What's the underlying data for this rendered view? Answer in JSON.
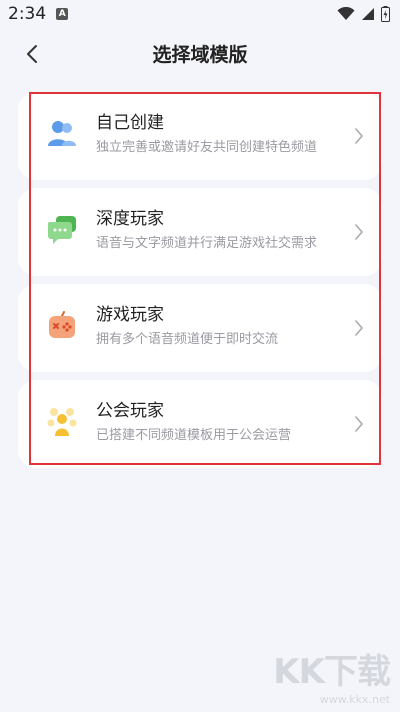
{
  "status": {
    "time": "2:34",
    "notif_glyph": "A"
  },
  "header": {
    "title": "选择域模版",
    "back_icon": "chevron-left-icon"
  },
  "templates": [
    {
      "title": "自己创建",
      "desc": "独立完善或邀请好友共同创建特色频道",
      "icon": "people-icon",
      "color": "#5b9bea"
    },
    {
      "title": "深度玩家",
      "desc": "语音与文字频道并行满足游戏社交需求",
      "icon": "chat-bubbles-icon",
      "color": "#6cc96e"
    },
    {
      "title": "游戏玩家",
      "desc": "拥有多个语音频道便于即时交流",
      "icon": "game-controller-icon",
      "color": "#f08a5c"
    },
    {
      "title": "公会玩家",
      "desc": "已搭建不同频道模板用于公会运营",
      "icon": "guild-icon",
      "color": "#f5c033"
    }
  ],
  "watermark": {
    "logo": "KK下载",
    "url": "www.kkx.net"
  }
}
